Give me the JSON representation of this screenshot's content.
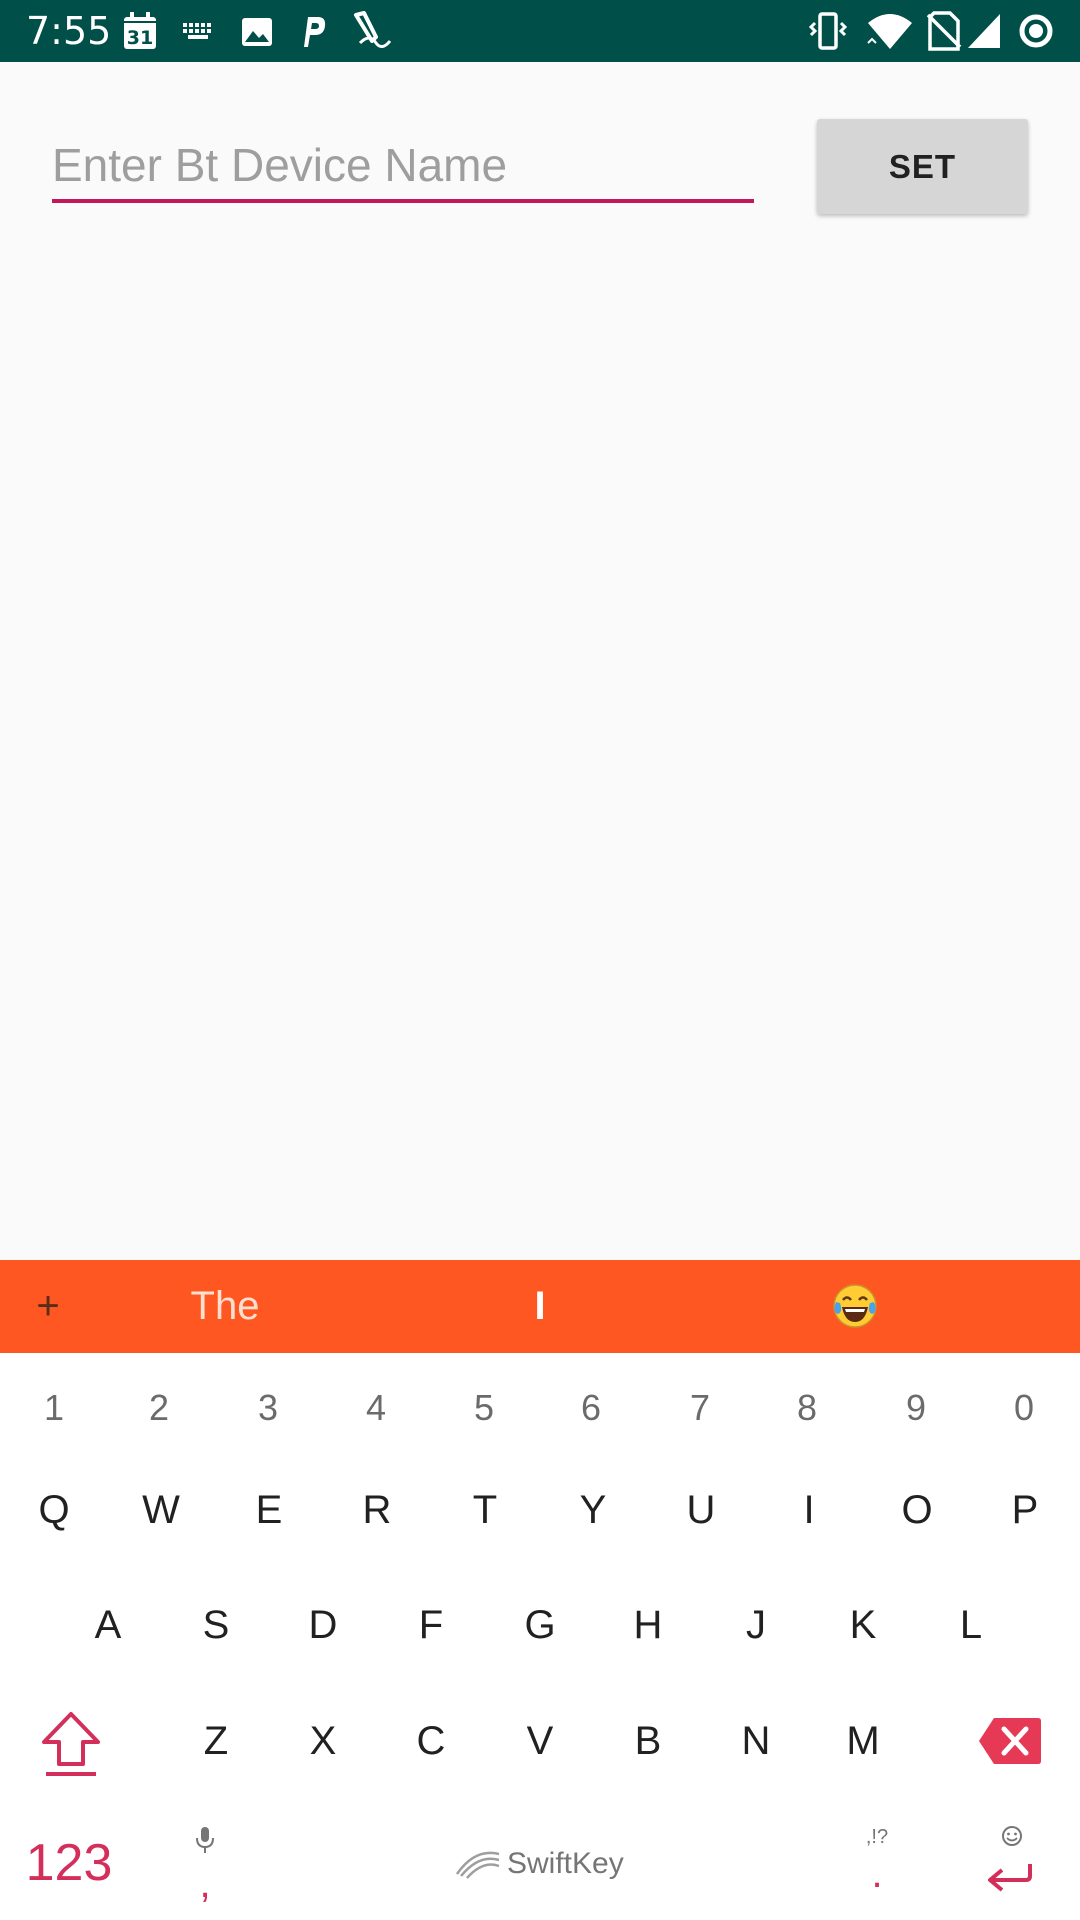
{
  "status_bar": {
    "time": "7:55",
    "calendar_day": "31",
    "left_icons": [
      "calendar-icon",
      "keyboard-icon",
      "image-icon",
      "parking-icon",
      "pen-icon"
    ],
    "right_icons": [
      "vibrate-icon",
      "wifi-icon",
      "no-sim-icon",
      "signal-icon",
      "sync-ring-icon"
    ]
  },
  "app": {
    "device_name_placeholder": "Enter Bt Device Name",
    "device_name_value": "",
    "set_label": "SET",
    "accent_color": "#c2185b"
  },
  "keyboard": {
    "suggestion_bar": {
      "add_symbol": "+",
      "suggestions": [
        "The",
        "I"
      ],
      "emoji": "😂",
      "color": "#ff5722"
    },
    "number_row": [
      "1",
      "2",
      "3",
      "4",
      "5",
      "6",
      "7",
      "8",
      "9",
      "0"
    ],
    "row1": [
      "Q",
      "W",
      "E",
      "R",
      "T",
      "Y",
      "U",
      "I",
      "O",
      "P"
    ],
    "row2": [
      "A",
      "S",
      "D",
      "F",
      "G",
      "H",
      "J",
      "K",
      "L"
    ],
    "row3": [
      "Z",
      "X",
      "C",
      "V",
      "B",
      "N",
      "M"
    ],
    "mode_label": "123",
    "comma": ",",
    "period": ".",
    "period_hint": ",!?",
    "brand": "SwiftKey",
    "accent_color": "#d32f5a"
  }
}
